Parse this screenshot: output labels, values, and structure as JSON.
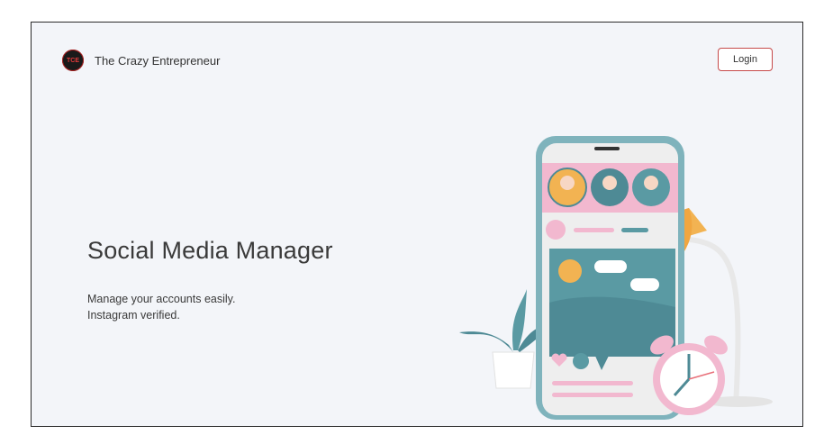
{
  "header": {
    "brand_name": "The Crazy Entrepreneur",
    "logo_text": "TCE",
    "login_label": "Login"
  },
  "hero": {
    "title": "Social Media Manager",
    "subtitle_line1": "Manage your accounts easily.",
    "subtitle_line2": "Instagram verified."
  },
  "colors": {
    "page_bg": "#f3f5f9",
    "login_border": "#c64a4a",
    "phone_frame": "#7fb3bc",
    "pink": "#f2b8cf",
    "teal": "#5a9aa3",
    "lamp_yellow": "#f2b352"
  },
  "icons": [
    "logo-icon",
    "phone-illustration",
    "plant-illustration",
    "lamp-illustration",
    "alarm-clock-illustration"
  ]
}
